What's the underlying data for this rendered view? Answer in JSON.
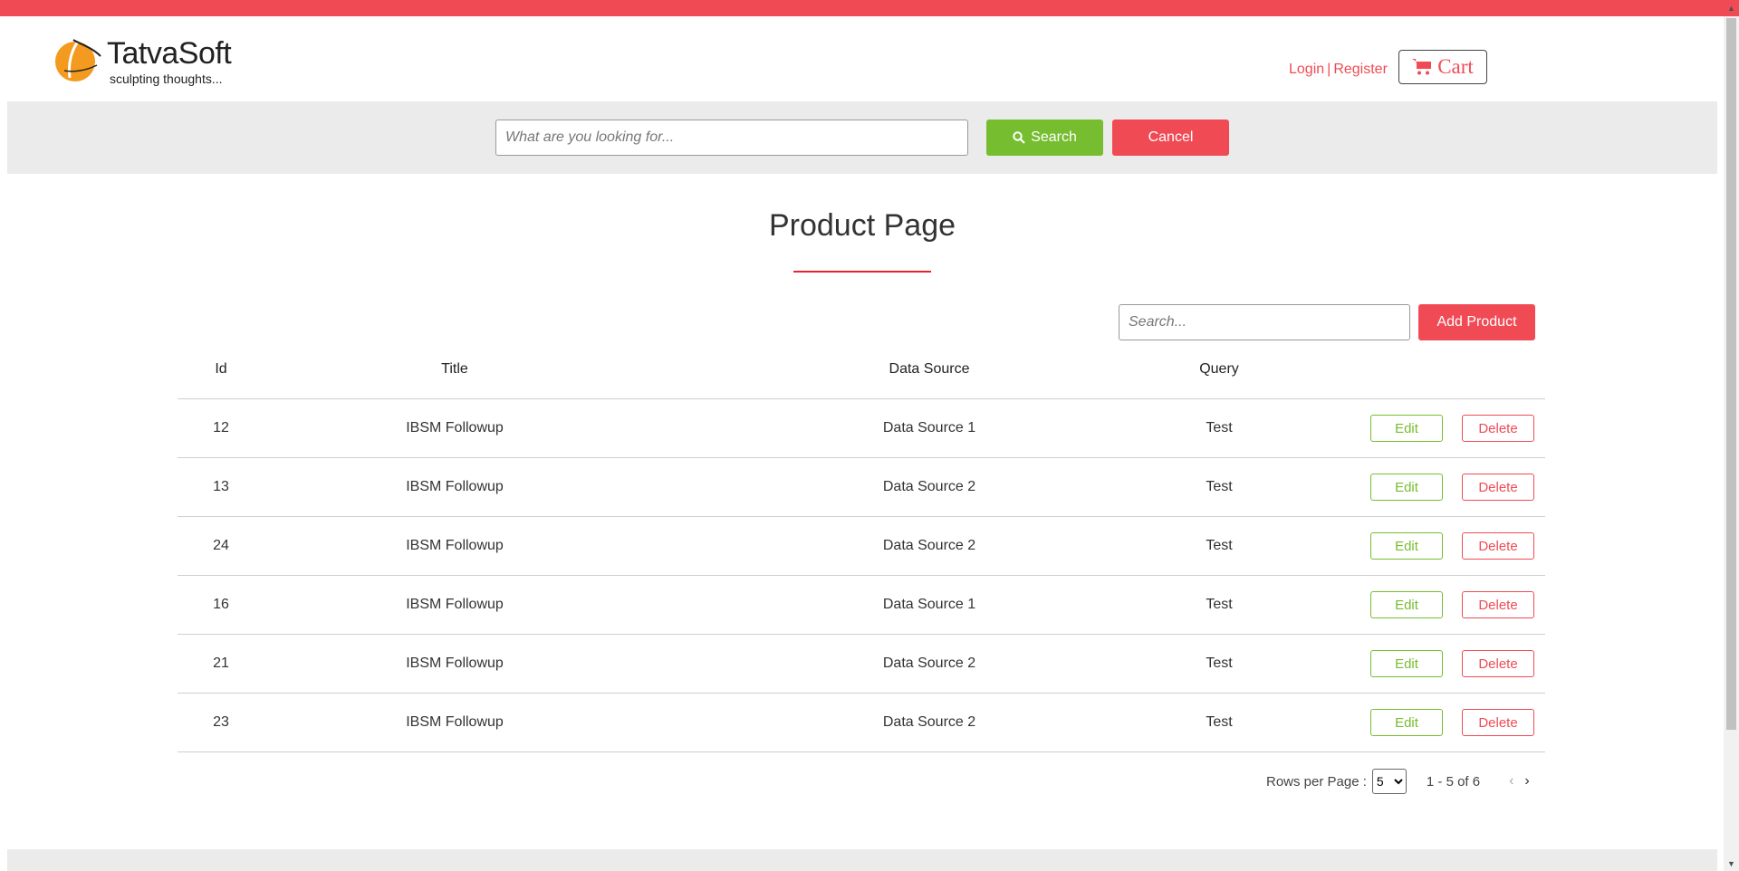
{
  "brand": {
    "name": "TatvaSoft",
    "tagline": "sculpting thoughts...",
    "accent_color": "#f04b55",
    "logo_color": "#f39a1f"
  },
  "header": {
    "login_label": "Login",
    "separator": "|",
    "register_label": "Register",
    "cart_label": "Cart",
    "cart_icon": "shopping-cart-icon"
  },
  "search": {
    "placeholder": "What are you looking for...",
    "value": "",
    "search_label": "Search",
    "search_icon": "search-icon",
    "cancel_label": "Cancel",
    "search_button_color": "#76bd2f"
  },
  "page": {
    "title": "Product Page"
  },
  "table_toolbar": {
    "search_placeholder": "Search...",
    "add_label": "Add Product"
  },
  "table": {
    "columns": [
      "Id",
      "Title",
      "Data Source",
      "Query"
    ],
    "edit_label": "Edit",
    "delete_label": "Delete",
    "rows": [
      {
        "id": "12",
        "title": "IBSM Followup",
        "data_source": "Data Source 1",
        "query": "Test"
      },
      {
        "id": "13",
        "title": "IBSM Followup",
        "data_source": "Data Source 2",
        "query": "Test"
      },
      {
        "id": "24",
        "title": "IBSM Followup",
        "data_source": "Data Source 2",
        "query": "Test"
      },
      {
        "id": "16",
        "title": "IBSM Followup",
        "data_source": "Data Source 1",
        "query": "Test"
      },
      {
        "id": "21",
        "title": "IBSM Followup",
        "data_source": "Data Source 2",
        "query": "Test"
      },
      {
        "id": "23",
        "title": "IBSM Followup",
        "data_source": "Data Source 2",
        "query": "Test"
      }
    ]
  },
  "pagination": {
    "rows_label": "Rows per Page :",
    "rows_value": "5",
    "range": "1 - 5 of 6",
    "prev_icon": "chevron-left-icon",
    "next_icon": "chevron-right-icon"
  }
}
